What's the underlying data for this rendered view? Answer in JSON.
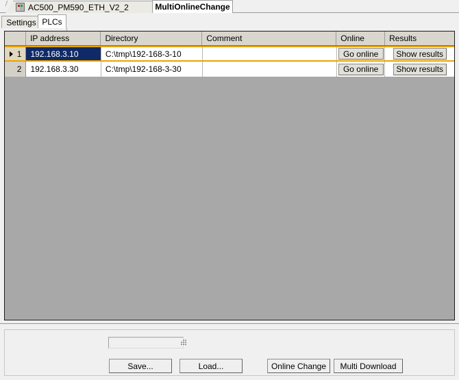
{
  "window": {
    "document_tabs": [
      {
        "label": "AC500_PM590_ETH_V2_2",
        "icon": "plc-device-icon",
        "active": false
      },
      {
        "label": "MultiOnlineChange",
        "active": true
      }
    ]
  },
  "subtabs": [
    {
      "label": "Settings",
      "active": false
    },
    {
      "label": "PLCs",
      "active": true
    }
  ],
  "grid": {
    "columns": [
      {
        "key": "rownum",
        "label": ""
      },
      {
        "key": "ip",
        "label": "IP address"
      },
      {
        "key": "directory",
        "label": "Directory"
      },
      {
        "key": "comment",
        "label": "Comment"
      },
      {
        "key": "online",
        "label": "Online"
      },
      {
        "key": "results",
        "label": "Results"
      }
    ],
    "rows": [
      {
        "rownum": "1",
        "ip": "192.168.3.10",
        "directory": "C:\\tmp\\192-168-3-10",
        "comment": "",
        "online_button": "Go online",
        "results_button": "Show results",
        "selected": true,
        "caret": true
      },
      {
        "rownum": "2",
        "ip": "192.168.3.30",
        "directory": "C:\\tmp\\192-168-3-30",
        "comment": "",
        "online_button": "Go online",
        "results_button": "Show results",
        "selected": false,
        "caret": false
      }
    ]
  },
  "bottom": {
    "progress_value": "",
    "buttons": {
      "save": "Save...",
      "load": "Load...",
      "online_change": "Online Change",
      "multi_download": "Multi Download"
    }
  },
  "colors": {
    "selection_border": "#e8a400",
    "selected_cell_bg": "#102a68",
    "grid_empty_bg": "#a8a8a8",
    "header_bg": "#d9d6cd",
    "panel_bg": "#f0f0f0"
  }
}
